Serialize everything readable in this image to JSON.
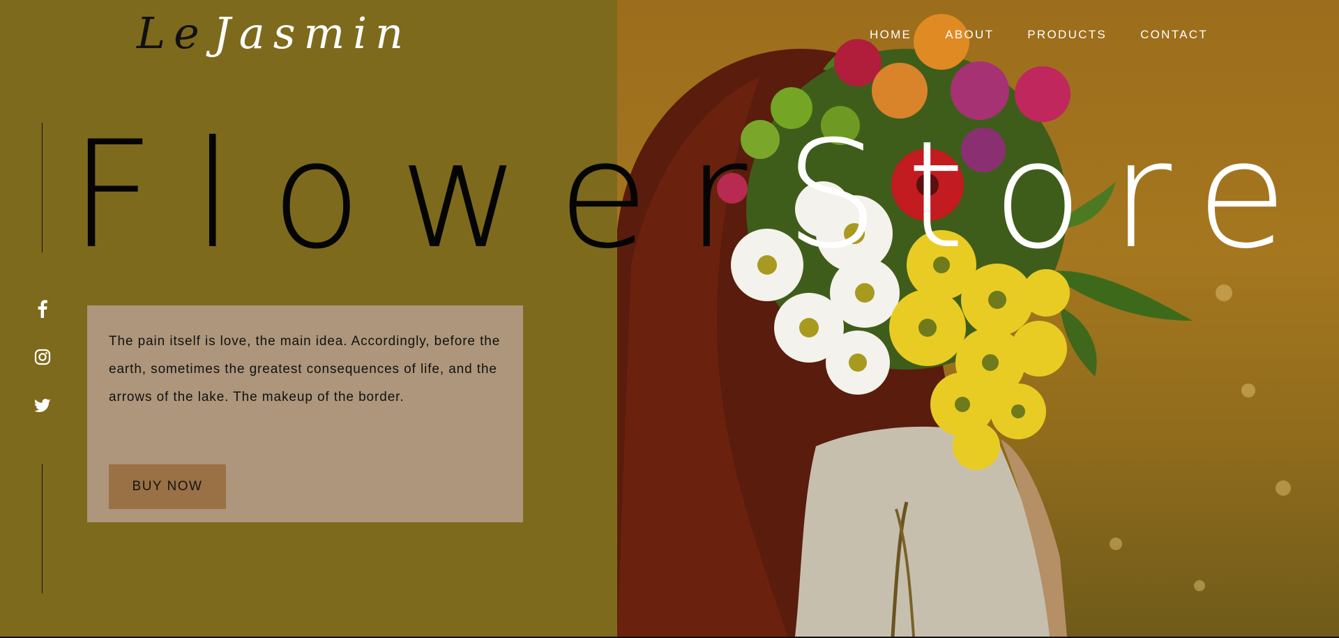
{
  "brand": {
    "logo_part1": "Le",
    "logo_part2": "Jasmin"
  },
  "nav": {
    "items": [
      {
        "label": "HOME"
      },
      {
        "label": "ABOUT"
      },
      {
        "label": "PRODUCTS"
      },
      {
        "label": "CONTACT"
      }
    ]
  },
  "hero": {
    "headline_part1": "Flower",
    "headline_part2": "Store",
    "description": "The pain itself is love, the main idea. Accordingly, before the earth, sometimes the greatest consequences of life, and the arrows of the lake. The makeup of the border.",
    "cta_label": "BUY NOW"
  },
  "social": [
    {
      "icon": "facebook-icon"
    },
    {
      "icon": "instagram-icon"
    },
    {
      "icon": "twitter-icon"
    }
  ],
  "colors": {
    "olive_panel": "#7e6a1c",
    "card_bg": "#ad967b",
    "button_bg": "#9a7045",
    "headline_dark": "#050505",
    "headline_light": "#ffffff"
  }
}
